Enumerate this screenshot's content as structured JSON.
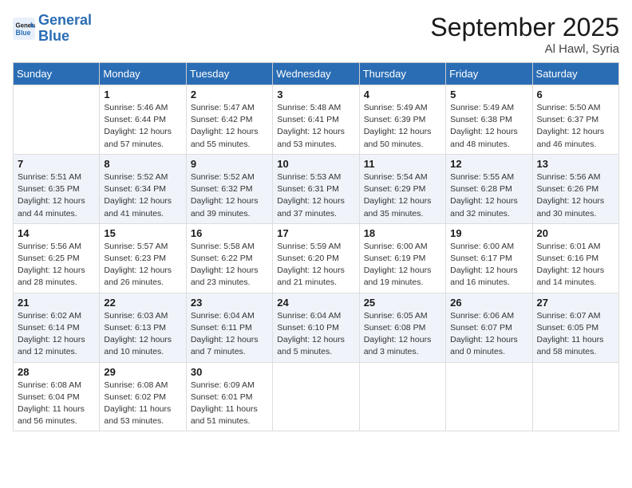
{
  "header": {
    "logo_line1": "General",
    "logo_line2": "Blue",
    "month": "September 2025",
    "location": "Al Hawl, Syria"
  },
  "weekdays": [
    "Sunday",
    "Monday",
    "Tuesday",
    "Wednesday",
    "Thursday",
    "Friday",
    "Saturday"
  ],
  "weeks": [
    [
      {
        "day": "",
        "info": ""
      },
      {
        "day": "1",
        "info": "Sunrise: 5:46 AM\nSunset: 6:44 PM\nDaylight: 12 hours\nand 57 minutes."
      },
      {
        "day": "2",
        "info": "Sunrise: 5:47 AM\nSunset: 6:42 PM\nDaylight: 12 hours\nand 55 minutes."
      },
      {
        "day": "3",
        "info": "Sunrise: 5:48 AM\nSunset: 6:41 PM\nDaylight: 12 hours\nand 53 minutes."
      },
      {
        "day": "4",
        "info": "Sunrise: 5:49 AM\nSunset: 6:39 PM\nDaylight: 12 hours\nand 50 minutes."
      },
      {
        "day": "5",
        "info": "Sunrise: 5:49 AM\nSunset: 6:38 PM\nDaylight: 12 hours\nand 48 minutes."
      },
      {
        "day": "6",
        "info": "Sunrise: 5:50 AM\nSunset: 6:37 PM\nDaylight: 12 hours\nand 46 minutes."
      }
    ],
    [
      {
        "day": "7",
        "info": "Sunrise: 5:51 AM\nSunset: 6:35 PM\nDaylight: 12 hours\nand 44 minutes."
      },
      {
        "day": "8",
        "info": "Sunrise: 5:52 AM\nSunset: 6:34 PM\nDaylight: 12 hours\nand 41 minutes."
      },
      {
        "day": "9",
        "info": "Sunrise: 5:52 AM\nSunset: 6:32 PM\nDaylight: 12 hours\nand 39 minutes."
      },
      {
        "day": "10",
        "info": "Sunrise: 5:53 AM\nSunset: 6:31 PM\nDaylight: 12 hours\nand 37 minutes."
      },
      {
        "day": "11",
        "info": "Sunrise: 5:54 AM\nSunset: 6:29 PM\nDaylight: 12 hours\nand 35 minutes."
      },
      {
        "day": "12",
        "info": "Sunrise: 5:55 AM\nSunset: 6:28 PM\nDaylight: 12 hours\nand 32 minutes."
      },
      {
        "day": "13",
        "info": "Sunrise: 5:56 AM\nSunset: 6:26 PM\nDaylight: 12 hours\nand 30 minutes."
      }
    ],
    [
      {
        "day": "14",
        "info": "Sunrise: 5:56 AM\nSunset: 6:25 PM\nDaylight: 12 hours\nand 28 minutes."
      },
      {
        "day": "15",
        "info": "Sunrise: 5:57 AM\nSunset: 6:23 PM\nDaylight: 12 hours\nand 26 minutes."
      },
      {
        "day": "16",
        "info": "Sunrise: 5:58 AM\nSunset: 6:22 PM\nDaylight: 12 hours\nand 23 minutes."
      },
      {
        "day": "17",
        "info": "Sunrise: 5:59 AM\nSunset: 6:20 PM\nDaylight: 12 hours\nand 21 minutes."
      },
      {
        "day": "18",
        "info": "Sunrise: 6:00 AM\nSunset: 6:19 PM\nDaylight: 12 hours\nand 19 minutes."
      },
      {
        "day": "19",
        "info": "Sunrise: 6:00 AM\nSunset: 6:17 PM\nDaylight: 12 hours\nand 16 minutes."
      },
      {
        "day": "20",
        "info": "Sunrise: 6:01 AM\nSunset: 6:16 PM\nDaylight: 12 hours\nand 14 minutes."
      }
    ],
    [
      {
        "day": "21",
        "info": "Sunrise: 6:02 AM\nSunset: 6:14 PM\nDaylight: 12 hours\nand 12 minutes."
      },
      {
        "day": "22",
        "info": "Sunrise: 6:03 AM\nSunset: 6:13 PM\nDaylight: 12 hours\nand 10 minutes."
      },
      {
        "day": "23",
        "info": "Sunrise: 6:04 AM\nSunset: 6:11 PM\nDaylight: 12 hours\nand 7 minutes."
      },
      {
        "day": "24",
        "info": "Sunrise: 6:04 AM\nSunset: 6:10 PM\nDaylight: 12 hours\nand 5 minutes."
      },
      {
        "day": "25",
        "info": "Sunrise: 6:05 AM\nSunset: 6:08 PM\nDaylight: 12 hours\nand 3 minutes."
      },
      {
        "day": "26",
        "info": "Sunrise: 6:06 AM\nSunset: 6:07 PM\nDaylight: 12 hours\nand 0 minutes."
      },
      {
        "day": "27",
        "info": "Sunrise: 6:07 AM\nSunset: 6:05 PM\nDaylight: 11 hours\nand 58 minutes."
      }
    ],
    [
      {
        "day": "28",
        "info": "Sunrise: 6:08 AM\nSunset: 6:04 PM\nDaylight: 11 hours\nand 56 minutes."
      },
      {
        "day": "29",
        "info": "Sunrise: 6:08 AM\nSunset: 6:02 PM\nDaylight: 11 hours\nand 53 minutes."
      },
      {
        "day": "30",
        "info": "Sunrise: 6:09 AM\nSunset: 6:01 PM\nDaylight: 11 hours\nand 51 minutes."
      },
      {
        "day": "",
        "info": ""
      },
      {
        "day": "",
        "info": ""
      },
      {
        "day": "",
        "info": ""
      },
      {
        "day": "",
        "info": ""
      }
    ]
  ]
}
